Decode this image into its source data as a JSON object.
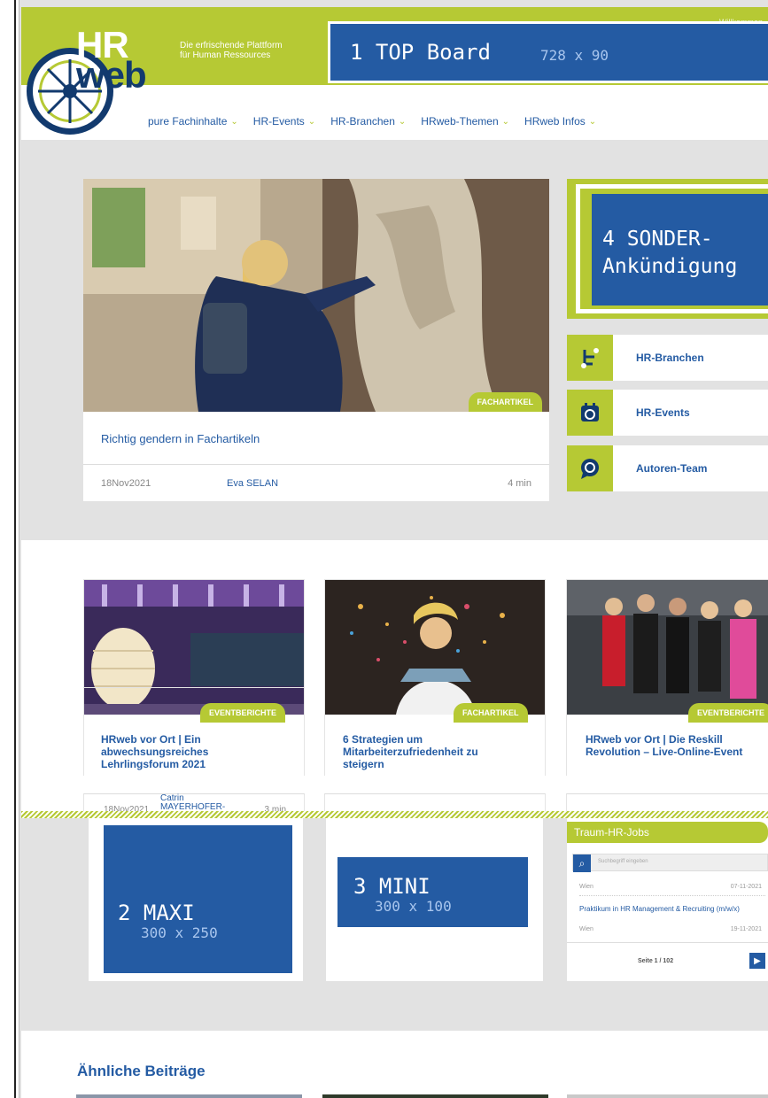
{
  "header": {
    "welcome": "Willkommen",
    "logo_hr": "HR",
    "logo_web": "web",
    "tagline_1": "Die erfrischende Plattform",
    "tagline_2": "für Human Ressources",
    "top_board": {
      "title": "1 TOP Board",
      "size": "728 x 90"
    }
  },
  "nav": {
    "items": [
      {
        "label": "pure Fachinhalte"
      },
      {
        "label": "HR-Events"
      },
      {
        "label": "HR-Branchen"
      },
      {
        "label": "HRweb-Themen"
      },
      {
        "label": "HRweb Infos"
      }
    ]
  },
  "featured": {
    "badge": "FACHARTIKEL",
    "title": "Richtig gendern in Fachartikeln",
    "date": "18Nov2021",
    "author": "Eva SELAN",
    "read_time": "4 min"
  },
  "sidebar": {
    "sonder_line1": "4 SONDER-",
    "sonder_line2": "Ankündigung",
    "links": [
      {
        "label": "HR-Branchen",
        "icon": "branch-icon"
      },
      {
        "label": "HR-Events",
        "icon": "calendar-icon"
      },
      {
        "label": "Autoren-Team",
        "icon": "speech-bubble-icon"
      }
    ]
  },
  "cards": [
    {
      "badge": "EVENTBERICHTE",
      "title": "HRweb vor Ort | Ein abwechsungsreiches Lehrlingsforum 2021",
      "date": "18Nov2021",
      "author_1": "Catrin",
      "author_2": "MAYERHOFER-",
      "read_time": "3 min"
    },
    {
      "badge": "FACHARTIKEL",
      "title": "6 Strategien um Mitarbeiterzufriedenheit zu steigern"
    },
    {
      "badge": "EVENTBERICHTE",
      "title": "HRweb vor Ort | Die Reskill Revolution – Live-Online-Event"
    }
  ],
  "ads": {
    "maxi": {
      "title": "2 MAXI",
      "size": "300 x 250"
    },
    "mini": {
      "title": "3 MINI",
      "size": "300 x 100"
    }
  },
  "jobs": {
    "title": "Traum-HR-Jobs",
    "search_placeholder": "Suchbegriff eingeben",
    "row1_location": "Wien",
    "row1_date": "07-11-2021",
    "job_title": "Praktikum in HR Management & Recruiting (m/w/x)",
    "row2_location": "Wien",
    "row2_date": "19-11-2021",
    "pagination": "Seite 1 / 102"
  },
  "related": {
    "title": "Ähnliche Beiträge"
  },
  "colors": {
    "brand_green": "#b6c934",
    "brand_blue": "#245ba3",
    "logo_navy": "#123a6e"
  }
}
